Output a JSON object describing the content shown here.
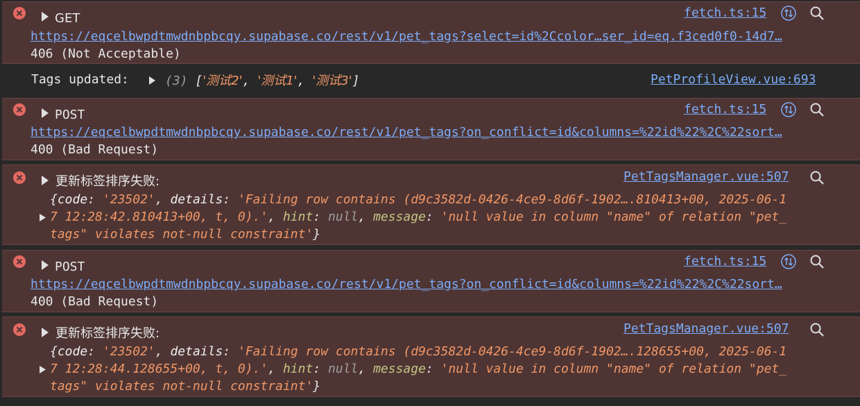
{
  "colors": {
    "error_bg": "#4e3534",
    "link": "#7cacf8",
    "string": "#f29766",
    "keyword": "#c5c584"
  },
  "entries": [
    {
      "method": "GET",
      "url": "https://eqcelbwpdtmwdnbpbcqy.supabase.co/rest/v1/pet_tags?select=id%2Ccolor…ser_id=eq.f3ced0f0-14d7…",
      "status": "406 (Not Acceptable)",
      "source": "fetch.ts:15"
    },
    {
      "label": "Tags updated: ",
      "count": "(3)",
      "array_open": "[",
      "items": [
        "'测试2'",
        "'测试1'",
        "'测试3'"
      ],
      "comma": ", ",
      "array_close": "]",
      "source": "PetProfileView.vue:693"
    },
    {
      "method": "POST",
      "url": "https://eqcelbwpdtmwdnbpbcqy.supabase.co/rest/v1/pet_tags?on_conflict=id&columns=%22id%22%2C%22sort…",
      "status": "400 (Bad Request)",
      "source": "fetch.ts:15"
    },
    {
      "title": "更新标签排序失败:",
      "source": "PetTagsManager.vue:507",
      "l1": {
        "open": "{",
        "k_code": "code",
        "colon": ": ",
        "v_code": "'23502'",
        "sep": ", ",
        "k_details": "details",
        "v_details": "'Failing row contains (d9c3582d-0426-4ce9-8d6f-1902….810413+00, 2025-06-1"
      },
      "l2": {
        "v_details_cont": "7 12:28:42.810413+00, t, 0).'",
        "sep": ", ",
        "k_hint": "hint",
        "colon": ": ",
        "v_hint": "null",
        "k_message": "message",
        "v_message": "'null value in column \"name\" of relation \"pet_"
      },
      "l3": {
        "v_message_cont": "tags\" violates not-null constraint'",
        "close": "}"
      }
    },
    {
      "method": "POST",
      "url": "https://eqcelbwpdtmwdnbpbcqy.supabase.co/rest/v1/pet_tags?on_conflict=id&columns=%22id%22%2C%22sort…",
      "status": "400 (Bad Request)",
      "source": "fetch.ts:15"
    },
    {
      "title": "更新标签排序失败:",
      "source": "PetTagsManager.vue:507",
      "l1": {
        "open": "{",
        "k_code": "code",
        "colon": ": ",
        "v_code": "'23502'",
        "sep": ", ",
        "k_details": "details",
        "v_details": "'Failing row contains (d9c3582d-0426-4ce9-8d6f-1902….128655+00, 2025-06-1"
      },
      "l2": {
        "v_details_cont": "7 12:28:44.128655+00, t, 0).'",
        "sep": ", ",
        "k_hint": "hint",
        "colon": ": ",
        "v_hint": "null",
        "k_message": "message",
        "v_message": "'null value in column \"name\" of relation \"pet_"
      },
      "l3": {
        "v_message_cont": "tags\" violates not-null constraint'",
        "close": "}"
      }
    }
  ]
}
